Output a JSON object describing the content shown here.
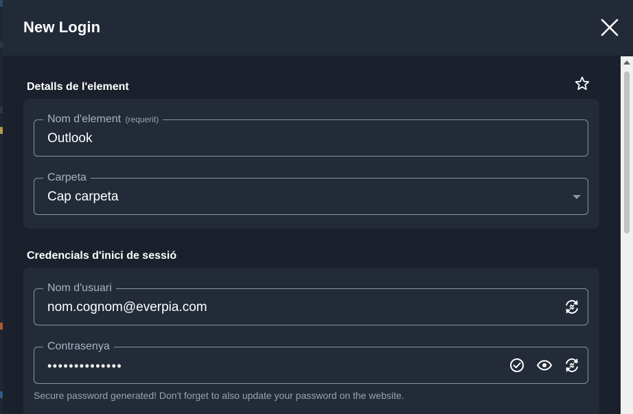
{
  "dialog": {
    "title": "New Login",
    "close_icon": "close-icon"
  },
  "item_details": {
    "section_title": "Detalls de l'element",
    "favorite_icon": "star-outline-icon",
    "name_field": {
      "label": "Nom d'element",
      "required_hint": "(requerit)",
      "value": "Outlook"
    },
    "folder_field": {
      "label": "Carpeta",
      "value": "Cap carpeta"
    }
  },
  "login_credentials": {
    "section_title": "Credencials d'inici de sessió",
    "username_field": {
      "label": "Nom d'usuari",
      "value": "nom.cognom@everpia.com",
      "generate_icon": "generate-icon"
    },
    "password_field": {
      "label": "Contrasenya",
      "masked_value": "••••••••••••••",
      "check_icon": "check-circle-icon",
      "visibility_icon": "eye-icon",
      "generate_icon": "generate-icon"
    },
    "helper_text": "Secure password generated! Don't forget to also update your password on the website."
  },
  "colors": {
    "page_background": "#1a202c",
    "header_background": "#222a38",
    "card_background": "#232a38",
    "field_border": "#8c96a6",
    "label_text": "#a9b3c2",
    "value_text": "#ffffff"
  }
}
